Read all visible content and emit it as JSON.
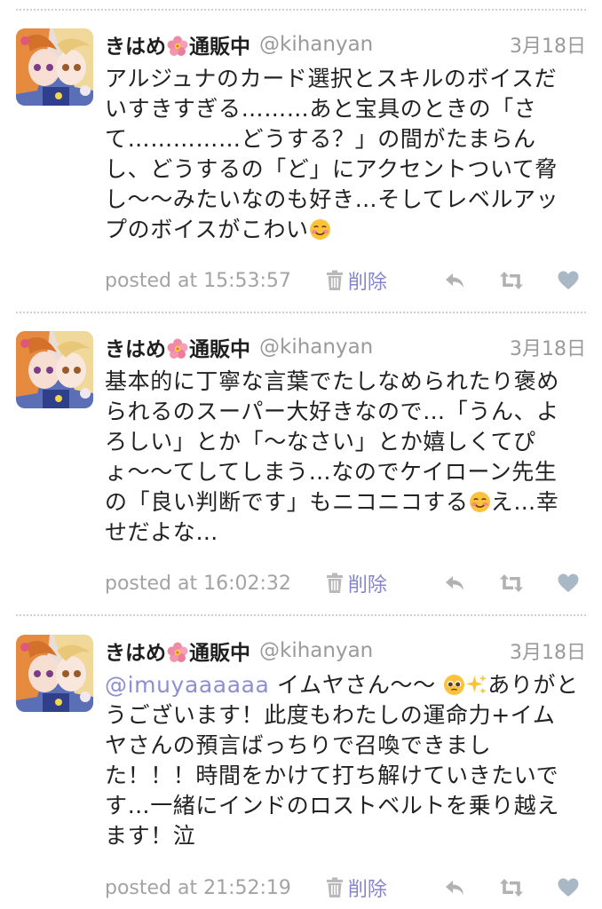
{
  "tweets": [
    {
      "user": {
        "name_before": "きはめ",
        "name_icon": "hibiscus-icon",
        "name_after": "通販中",
        "handle": "@kihanyan",
        "avatar": "avatar-image"
      },
      "date": "3月18日",
      "lines": [
        "アルジュナのカード選択とスキルのボイスだ",
        "いすきすぎる………あと宝具のときの「さ",
        "て……………どうする？」の間がたまらん",
        "し、どうするの「ど」にアクセントついて脅",
        "し〜〜みたいなのも好き…そしてレベルアッ",
        "プのボイスがこわい"
      ],
      "trailing_emoji": "smiling-face-icon",
      "posted_at": "posted at 15:53:57",
      "delete_label": "削除",
      "icons": {
        "delete": "trash-icon",
        "reply": "reply-icon",
        "retweet": "retweet-icon",
        "like": "heart-icon"
      }
    },
    {
      "user": {
        "name_before": "きはめ",
        "name_icon": "hibiscus-icon",
        "name_after": "通販中",
        "handle": "@kihanyan",
        "avatar": "avatar-image"
      },
      "date": "3月18日",
      "lines": [
        "基本的に丁寧な言葉でたしなめられたり褒め",
        "られるのスーパー大好きなので…「うん、よ",
        "ろしい」とか「〜なさい」とか嬉しくてぴ",
        "ょ〜〜てしてしまう…なのでケイローン先生",
        "の「良い判断です」もニコニコする",
        "せだよな…"
      ],
      "line5_emoji": "smiling-face-icon",
      "line5_after": "え…幸",
      "posted_at": "posted at 16:02:32",
      "delete_label": "削除",
      "icons": {
        "delete": "trash-icon",
        "reply": "reply-icon",
        "retweet": "retweet-icon",
        "like": "heart-icon"
      }
    },
    {
      "user": {
        "name_before": "きはめ",
        "name_icon": "hibiscus-icon",
        "name_after": "通販中",
        "handle": "@kihanyan",
        "avatar": "avatar-image"
      },
      "date": "3月18日",
      "mention": "@imuyaaaaaa",
      "line1_rest": " イムヤさん〜〜 ",
      "line1_emojis": [
        "pleading-face-icon",
        "sparkles-icon"
      ],
      "line1_after": "ありがと",
      "lines": [
        "うございます！此度もわたしの運命力+イム",
        "ヤさんの預言ばっちりで召喚できまし",
        "た！！！時間をかけて打ち解けていきたいで",
        "す…一緒にインドのロストベルトを乗り越え",
        "ます！泣"
      ],
      "posted_at": "posted at 21:52:19",
      "delete_label": "削除",
      "icons": {
        "delete": "trash-icon",
        "reply": "reply-icon",
        "retweet": "retweet-icon",
        "like": "heart-icon"
      }
    }
  ]
}
